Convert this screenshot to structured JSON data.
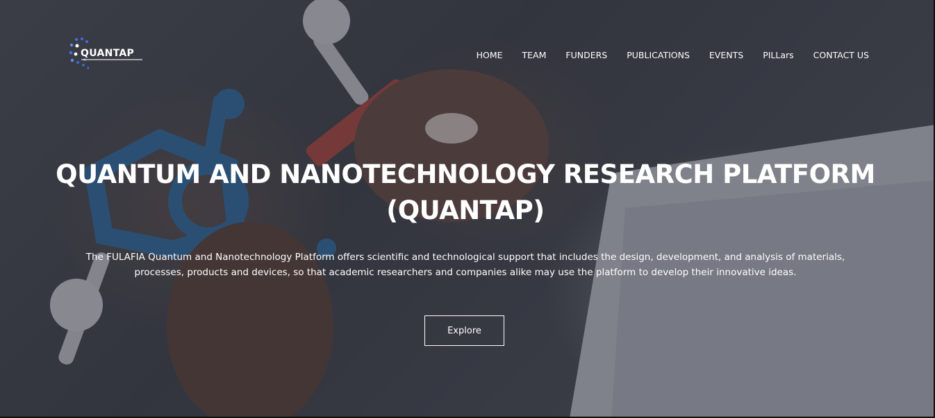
{
  "brand": {
    "name": "QUANTAP",
    "logo_icon": "molecule-dots-icon",
    "accent": "#3b6fe0"
  },
  "nav": {
    "items": [
      {
        "label": "HOME"
      },
      {
        "label": "TEAM"
      },
      {
        "label": "FUNDERS"
      },
      {
        "label": "PUBLICATIONS"
      },
      {
        "label": "EVENTS"
      },
      {
        "label": "PILLars"
      },
      {
        "label": "CONTACT US"
      }
    ]
  },
  "hero": {
    "title": "QUANTUM AND NANOTECHNOLOGY RESEARCH PLATFORM (QUANTAP)",
    "description": "The FULAFIA Quantum and Nanotechnology Platform offers scientific and technological support that includes the design, development, and analysis of materials, processes, products and devices, so that academic researchers and companies alike may use the platform to develop their innovative ideas.",
    "cta_label": "Explore",
    "background_image": "hands-holding-molecule-model-image"
  },
  "colors": {
    "text": "#ffffff",
    "overlay": "#282a34"
  }
}
